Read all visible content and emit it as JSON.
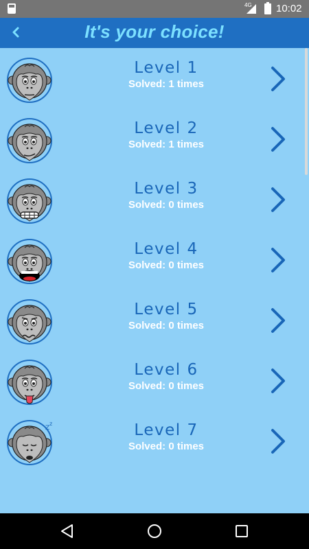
{
  "status_bar": {
    "network": "4G",
    "time": "10:02"
  },
  "app_bar": {
    "title": "It's your choice!",
    "back_icon": "back-arrow-icon"
  },
  "levels": [
    {
      "label": "Level 1",
      "solved": "Solved: 1 times",
      "face": "neutral"
    },
    {
      "label": "Level 2",
      "solved": "Solved: 1 times",
      "face": "smirk"
    },
    {
      "label": "Level 3",
      "solved": "Solved: 0 times",
      "face": "grin"
    },
    {
      "label": "Level 4",
      "solved": "Solved: 0 times",
      "face": "scream"
    },
    {
      "label": "Level 5",
      "solved": "Solved: 0 times",
      "face": "wavy"
    },
    {
      "label": "Level 6",
      "solved": "Solved: 0 times",
      "face": "tongue"
    },
    {
      "label": "Level 7",
      "solved": "Solved: 0 times",
      "face": "sleeping"
    }
  ],
  "nav_bar": {
    "icons": [
      "back-triangle-icon",
      "home-circle-icon",
      "recents-square-icon"
    ]
  },
  "colors": {
    "app_bar": "#1f6fc2",
    "background": "#8fd0f7",
    "level_text": "#1966b8",
    "title": "#7ce0ff",
    "chevron": "#1966b8"
  }
}
